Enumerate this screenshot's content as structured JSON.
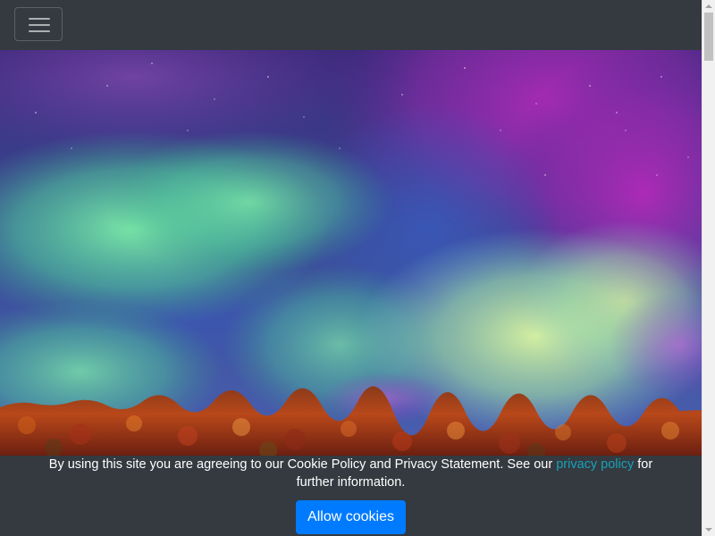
{
  "navbar": {
    "toggler_icon": "hamburger-menu-icon",
    "background_color": "#343a40"
  },
  "hero": {
    "image": "aurora-borealis-over-autumn-forest"
  },
  "cookie_banner": {
    "text_before_link": "By using this site you are agreeing to our Cookie Policy and Privacy Statement. See our ",
    "link_text": "privacy policy",
    "text_after_link": " for further information.",
    "button_label": "Allow cookies",
    "link_color": "#17a2b8",
    "button_color": "#007bff",
    "background_color": "#343a40"
  }
}
